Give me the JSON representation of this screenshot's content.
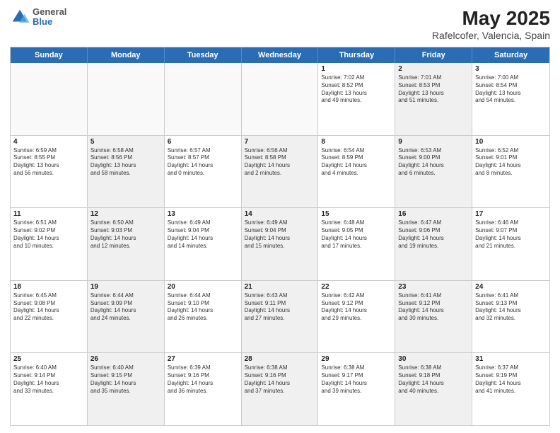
{
  "header": {
    "logo_general": "General",
    "logo_blue": "Blue",
    "main_title": "May 2025",
    "subtitle": "Rafelcofer, Valencia, Spain"
  },
  "days_of_week": [
    "Sunday",
    "Monday",
    "Tuesday",
    "Wednesday",
    "Thursday",
    "Friday",
    "Saturday"
  ],
  "weeks": [
    [
      {
        "day": "",
        "info": "",
        "shaded": false,
        "empty": true
      },
      {
        "day": "",
        "info": "",
        "shaded": false,
        "empty": true
      },
      {
        "day": "",
        "info": "",
        "shaded": false,
        "empty": true
      },
      {
        "day": "",
        "info": "",
        "shaded": false,
        "empty": true
      },
      {
        "day": "1",
        "info": "Sunrise: 7:02 AM\nSunset: 8:52 PM\nDaylight: 13 hours\nand 49 minutes.",
        "shaded": false,
        "empty": false
      },
      {
        "day": "2",
        "info": "Sunrise: 7:01 AM\nSunset: 8:53 PM\nDaylight: 13 hours\nand 51 minutes.",
        "shaded": true,
        "empty": false
      },
      {
        "day": "3",
        "info": "Sunrise: 7:00 AM\nSunset: 8:54 PM\nDaylight: 13 hours\nand 54 minutes.",
        "shaded": false,
        "empty": false
      }
    ],
    [
      {
        "day": "4",
        "info": "Sunrise: 6:59 AM\nSunset: 8:55 PM\nDaylight: 13 hours\nand 56 minutes.",
        "shaded": false,
        "empty": false
      },
      {
        "day": "5",
        "info": "Sunrise: 6:58 AM\nSunset: 8:56 PM\nDaylight: 13 hours\nand 58 minutes.",
        "shaded": true,
        "empty": false
      },
      {
        "day": "6",
        "info": "Sunrise: 6:57 AM\nSunset: 8:57 PM\nDaylight: 14 hours\nand 0 minutes.",
        "shaded": false,
        "empty": false
      },
      {
        "day": "7",
        "info": "Sunrise: 6:56 AM\nSunset: 8:58 PM\nDaylight: 14 hours\nand 2 minutes.",
        "shaded": true,
        "empty": false
      },
      {
        "day": "8",
        "info": "Sunrise: 6:54 AM\nSunset: 8:59 PM\nDaylight: 14 hours\nand 4 minutes.",
        "shaded": false,
        "empty": false
      },
      {
        "day": "9",
        "info": "Sunrise: 6:53 AM\nSunset: 9:00 PM\nDaylight: 14 hours\nand 6 minutes.",
        "shaded": true,
        "empty": false
      },
      {
        "day": "10",
        "info": "Sunrise: 6:52 AM\nSunset: 9:01 PM\nDaylight: 14 hours\nand 8 minutes.",
        "shaded": false,
        "empty": false
      }
    ],
    [
      {
        "day": "11",
        "info": "Sunrise: 6:51 AM\nSunset: 9:02 PM\nDaylight: 14 hours\nand 10 minutes.",
        "shaded": false,
        "empty": false
      },
      {
        "day": "12",
        "info": "Sunrise: 6:50 AM\nSunset: 9:03 PM\nDaylight: 14 hours\nand 12 minutes.",
        "shaded": true,
        "empty": false
      },
      {
        "day": "13",
        "info": "Sunrise: 6:49 AM\nSunset: 9:04 PM\nDaylight: 14 hours\nand 14 minutes.",
        "shaded": false,
        "empty": false
      },
      {
        "day": "14",
        "info": "Sunrise: 6:49 AM\nSunset: 9:04 PM\nDaylight: 14 hours\nand 15 minutes.",
        "shaded": true,
        "empty": false
      },
      {
        "day": "15",
        "info": "Sunrise: 6:48 AM\nSunset: 9:05 PM\nDaylight: 14 hours\nand 17 minutes.",
        "shaded": false,
        "empty": false
      },
      {
        "day": "16",
        "info": "Sunrise: 6:47 AM\nSunset: 9:06 PM\nDaylight: 14 hours\nand 19 minutes.",
        "shaded": true,
        "empty": false
      },
      {
        "day": "17",
        "info": "Sunrise: 6:46 AM\nSunset: 9:07 PM\nDaylight: 14 hours\nand 21 minutes.",
        "shaded": false,
        "empty": false
      }
    ],
    [
      {
        "day": "18",
        "info": "Sunrise: 6:45 AM\nSunset: 9:08 PM\nDaylight: 14 hours\nand 22 minutes.",
        "shaded": false,
        "empty": false
      },
      {
        "day": "19",
        "info": "Sunrise: 6:44 AM\nSunset: 9:09 PM\nDaylight: 14 hours\nand 24 minutes.",
        "shaded": true,
        "empty": false
      },
      {
        "day": "20",
        "info": "Sunrise: 6:44 AM\nSunset: 9:10 PM\nDaylight: 14 hours\nand 26 minutes.",
        "shaded": false,
        "empty": false
      },
      {
        "day": "21",
        "info": "Sunrise: 6:43 AM\nSunset: 9:11 PM\nDaylight: 14 hours\nand 27 minutes.",
        "shaded": true,
        "empty": false
      },
      {
        "day": "22",
        "info": "Sunrise: 6:42 AM\nSunset: 9:12 PM\nDaylight: 14 hours\nand 29 minutes.",
        "shaded": false,
        "empty": false
      },
      {
        "day": "23",
        "info": "Sunrise: 6:41 AM\nSunset: 9:12 PM\nDaylight: 14 hours\nand 30 minutes.",
        "shaded": true,
        "empty": false
      },
      {
        "day": "24",
        "info": "Sunrise: 6:41 AM\nSunset: 9:13 PM\nDaylight: 14 hours\nand 32 minutes.",
        "shaded": false,
        "empty": false
      }
    ],
    [
      {
        "day": "25",
        "info": "Sunrise: 6:40 AM\nSunset: 9:14 PM\nDaylight: 14 hours\nand 33 minutes.",
        "shaded": false,
        "empty": false
      },
      {
        "day": "26",
        "info": "Sunrise: 6:40 AM\nSunset: 9:15 PM\nDaylight: 14 hours\nand 35 minutes.",
        "shaded": true,
        "empty": false
      },
      {
        "day": "27",
        "info": "Sunrise: 6:39 AM\nSunset: 9:16 PM\nDaylight: 14 hours\nand 36 minutes.",
        "shaded": false,
        "empty": false
      },
      {
        "day": "28",
        "info": "Sunrise: 6:38 AM\nSunset: 9:16 PM\nDaylight: 14 hours\nand 37 minutes.",
        "shaded": true,
        "empty": false
      },
      {
        "day": "29",
        "info": "Sunrise: 6:38 AM\nSunset: 9:17 PM\nDaylight: 14 hours\nand 39 minutes.",
        "shaded": false,
        "empty": false
      },
      {
        "day": "30",
        "info": "Sunrise: 6:38 AM\nSunset: 9:18 PM\nDaylight: 14 hours\nand 40 minutes.",
        "shaded": true,
        "empty": false
      },
      {
        "day": "31",
        "info": "Sunrise: 6:37 AM\nSunset: 9:19 PM\nDaylight: 14 hours\nand 41 minutes.",
        "shaded": false,
        "empty": false
      }
    ]
  ]
}
